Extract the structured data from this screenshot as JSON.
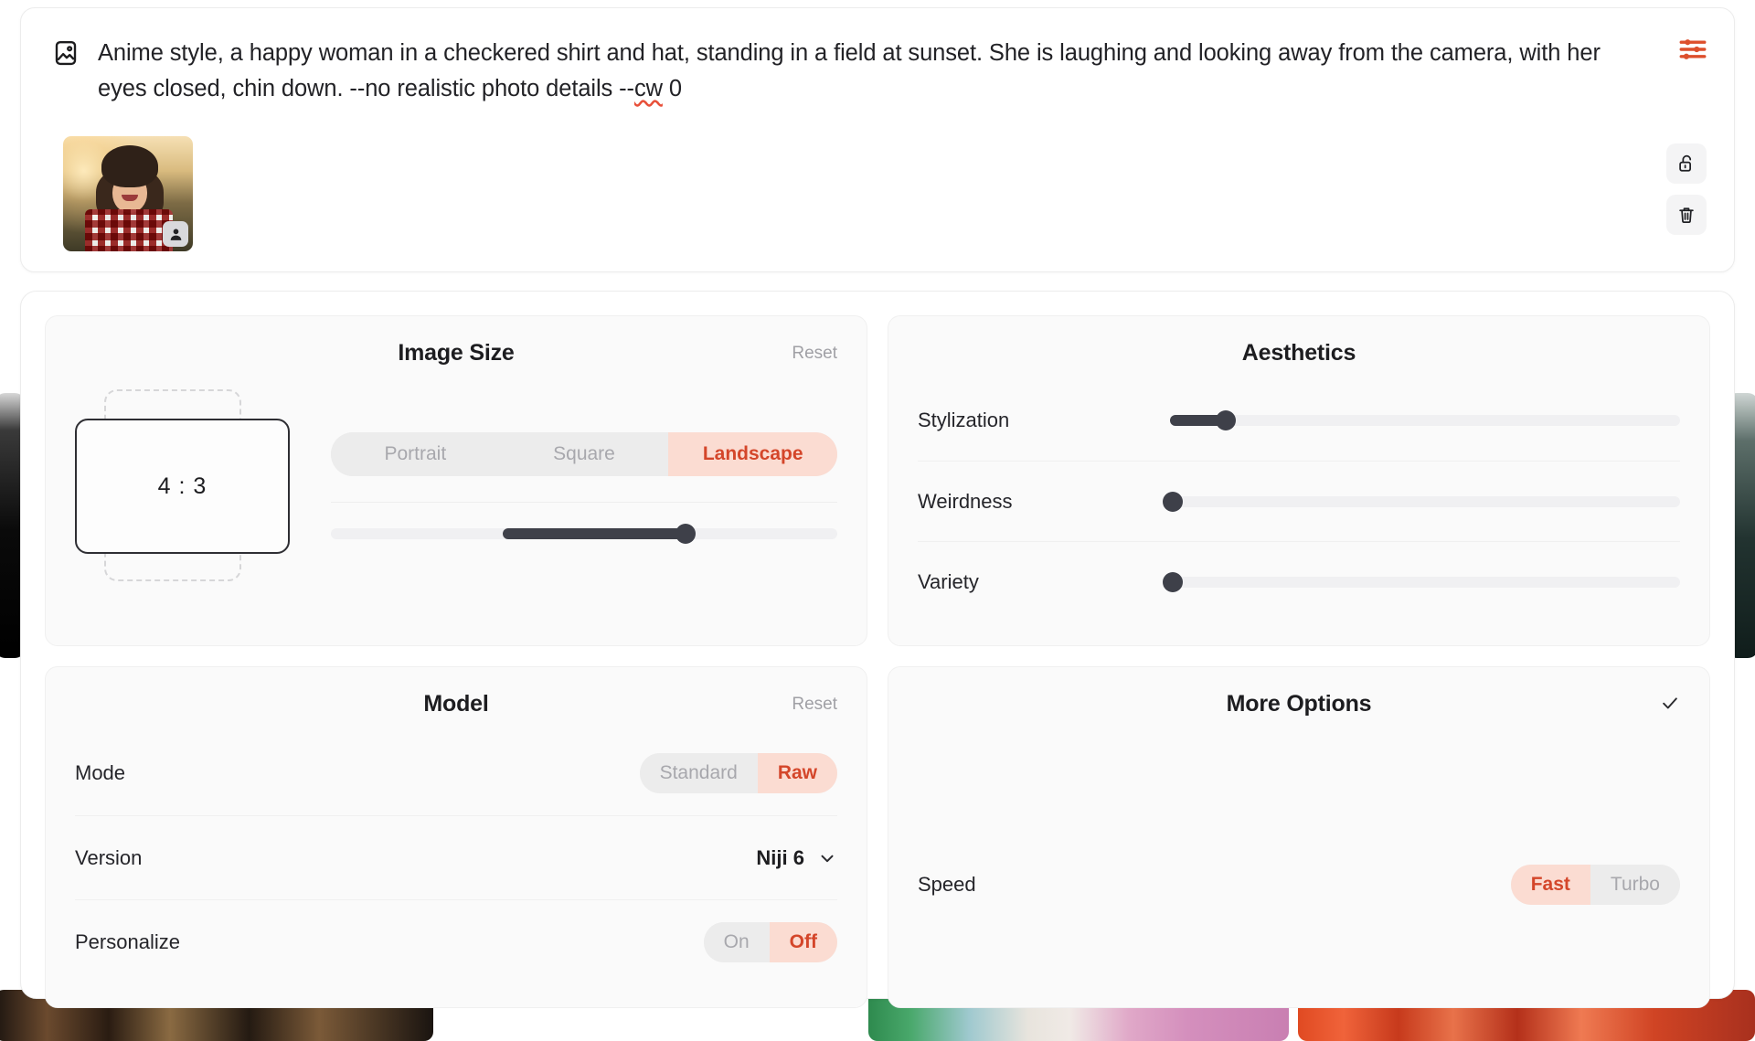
{
  "prompt_bar": {
    "icon": "image-icon",
    "text_before": "Anime style, a happy woman in a checkered shirt and hat, standing in a field at sunset. She is laughing and looking away from the camera, with her eyes closed, chin down. --no realistic photo details --",
    "misspelled_token": "cw",
    "text_after": " 0",
    "full_text": "Anime style, a happy woman in a checkered shirt and hat, standing in a field at sunset. She is laughing and looking away from the camera, with her eyes closed, chin down. --no realistic photo details --cw 0",
    "settings_icon": "sliders-icon",
    "lock_icon": "unlock-icon",
    "delete_icon": "trash-icon",
    "thumbnail": {
      "alt": "woman in checkered shirt and hat at sunset",
      "badge_icon": "person-icon"
    }
  },
  "panels": {
    "image_size": {
      "title": "Image Size",
      "reset_label": "Reset",
      "ratio_value": "4 : 3",
      "orientation_options": [
        "Portrait",
        "Square",
        "Landscape"
      ],
      "orientation_selected": "Landscape",
      "size_slider": {
        "fill_start_percent": 34,
        "value_percent": 70
      }
    },
    "aesthetics": {
      "title": "Aesthetics",
      "rows": [
        {
          "label": "Stylization",
          "value_percent": 11
        },
        {
          "label": "Weirdness",
          "value_percent": 0
        },
        {
          "label": "Variety",
          "value_percent": 0
        }
      ]
    },
    "model": {
      "title": "Model",
      "reset_label": "Reset",
      "mode": {
        "label": "Mode",
        "options": [
          "Standard",
          "Raw"
        ],
        "selected": "Raw"
      },
      "version": {
        "label": "Version",
        "value": "Niji 6",
        "chevron": "chevron-down-icon"
      },
      "personalize": {
        "label": "Personalize",
        "options": [
          "On",
          "Off"
        ],
        "selected": "Off"
      }
    },
    "more_options": {
      "title": "More Options",
      "check_icon": "check-icon",
      "speed": {
        "label": "Speed",
        "options": [
          "Fast",
          "Turbo"
        ],
        "selected": "Fast"
      }
    }
  },
  "colors": {
    "accent_red": "#d4462a",
    "accent_red_bg": "#fbdcd2",
    "slider_dark": "#3e4049",
    "panel_bg": "#fafafa",
    "track_gray": "#f0f0f2"
  }
}
